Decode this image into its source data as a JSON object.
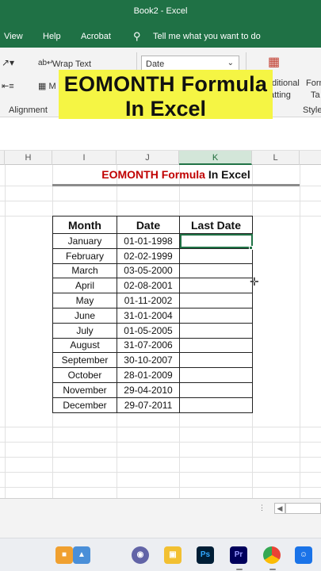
{
  "window": {
    "title": "Book2 - Excel"
  },
  "menu": {
    "items": [
      "View",
      "Help",
      "Acrobat"
    ],
    "tell_me": "Tell me what you want to do"
  },
  "ribbon": {
    "wrap_text": "Wrap Text",
    "number_format": "Date",
    "group_alignment": "Alignment",
    "conditional_partial_1": "ditional",
    "conditional_partial_2": "atting",
    "format_partial_1": "Form",
    "format_partial_2": "Ta",
    "styles_partial": "Style"
  },
  "overlay": {
    "line1": "EOMONTH Formula",
    "line2": "In Excel"
  },
  "columns": [
    "H",
    "I",
    "J",
    "K",
    "L"
  ],
  "sheet_banner": {
    "red": "EOMONTH Formula",
    "dark": "In Excel"
  },
  "table": {
    "headers": [
      "Month",
      "Date",
      "Last Date"
    ],
    "rows": [
      [
        "January",
        "01-01-1998",
        ""
      ],
      [
        "February",
        "02-02-1999",
        ""
      ],
      [
        "March",
        "03-05-2000",
        ""
      ],
      [
        "April",
        "02-08-2001",
        ""
      ],
      [
        "May",
        "01-11-2002",
        ""
      ],
      [
        "June",
        "31-01-2004",
        ""
      ],
      [
        "July",
        "01-05-2005",
        ""
      ],
      [
        "August",
        "31-07-2006",
        ""
      ],
      [
        "September",
        "30-10-2007",
        ""
      ],
      [
        "October",
        "28-01-2009",
        ""
      ],
      [
        "November",
        "29-04-2010",
        ""
      ],
      [
        "December",
        "29-07-2011",
        ""
      ]
    ]
  },
  "taskbar": {
    "icons": [
      "widgets-icon",
      "teams-icon",
      "file-explorer-icon",
      "photoshop-icon",
      "premiere-icon",
      "chrome-icon",
      "accessibility-icon"
    ],
    "labels": {
      "ps": "Ps",
      "pr": "Pr"
    }
  },
  "colors": {
    "excel_green": "#1f7145",
    "banner_red": "#c00000",
    "overlay_yellow": "#f5f544"
  }
}
